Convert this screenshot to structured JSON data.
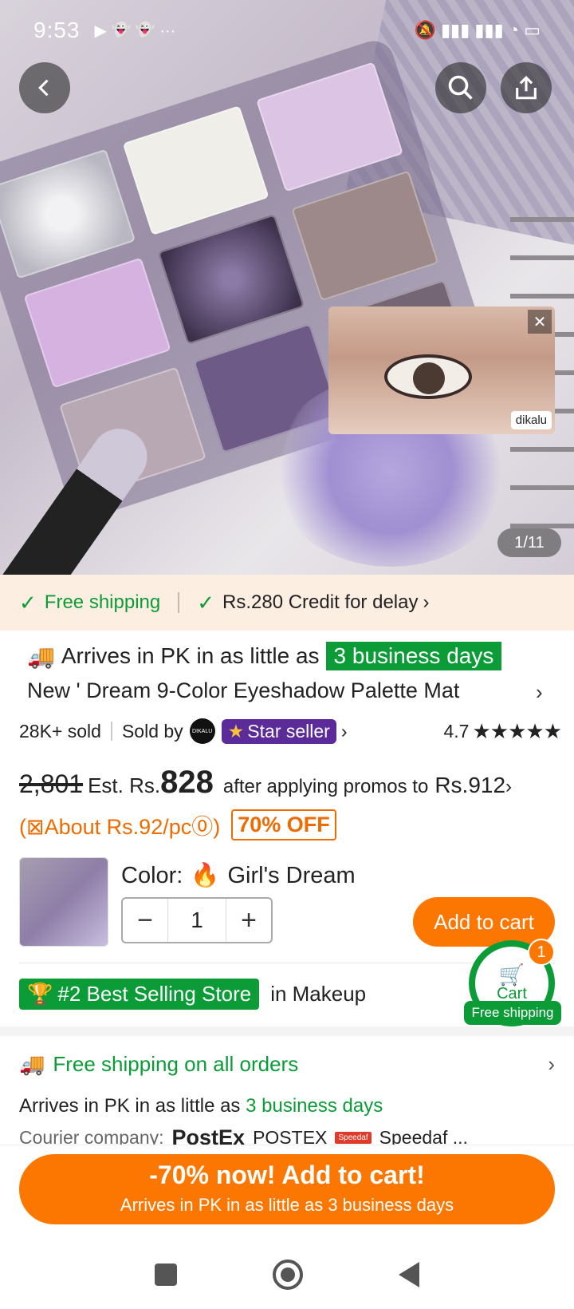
{
  "status_bar": {
    "time": "9:53",
    "icons_left": "▶ 👻 👻 ···",
    "icons_right": "🔕 ▮▮▮ ▮▮▮ ◔ ▭"
  },
  "hero": {
    "counter": "1/11",
    "video_tag": "dikalu",
    "video_close": "✕"
  },
  "promo_strip": {
    "free_shipping": "Free shipping",
    "credit": "Rs.280 Credit for delay",
    "credit_arrow": "›"
  },
  "product": {
    "arrives_prefix": "Arrives in PK in as little as",
    "arrives_days": "3 business days",
    "title": "New ' Dream 9-Color Eyeshadow Palette Mat",
    "title_arrow": "›",
    "sold": "28K+ sold",
    "sold_by": "Sold by",
    "seller_logo_text": "DIKALU",
    "star_seller": "Star seller",
    "rating": "4.7",
    "stars": "★★★★★",
    "old_price": "2,801",
    "est_label": "Est. Rs.",
    "est_price": "828",
    "after_promos": "after applying promos to",
    "promo_price": "Rs.912",
    "per_piece": "(⊠About Rs.92/pc⓪)",
    "discount": "70% OFF"
  },
  "variant": {
    "color_label": "Color:",
    "color_value": "Girl's Dream",
    "qty_minus": "−",
    "qty_value": "1",
    "qty_plus": "+",
    "add_to_cart": "Add to cart"
  },
  "store": {
    "badge": "#2 Best Selling Store",
    "category": "in Makeup"
  },
  "cart_float": {
    "label": "Cart",
    "count": "1",
    "free_shipping": "Free shipping"
  },
  "shipping": {
    "title": "Free shipping on all orders",
    "arrow": "›",
    "arrives_prefix": "Arrives in PK in as little as",
    "arrives_days": "3 business days",
    "courier_label": "Courier company:",
    "courier_1": "PostEx",
    "courier_2": "POSTEX",
    "courier_3_logo": "Speedaf",
    "courier_3": "Speedaf ..."
  },
  "cta": {
    "line1": "-70% now! Add to cart!",
    "line2": "Arrives in PK in as little as 3 business days"
  }
}
